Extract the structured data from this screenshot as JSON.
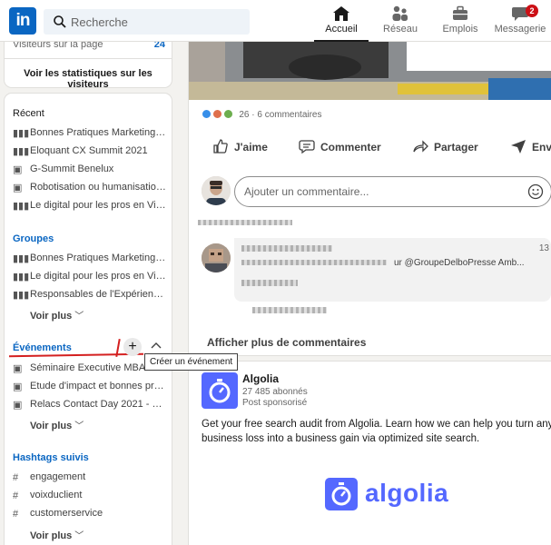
{
  "topbar": {
    "logo": "in",
    "search_placeholder": "Recherche",
    "nav": [
      {
        "label": "Accueil"
      },
      {
        "label": "Réseau"
      },
      {
        "label": "Emplois"
      },
      {
        "label": "Messagerie",
        "badge": "2"
      }
    ]
  },
  "left": {
    "stats": {
      "label": "Visiteurs sur la page",
      "count": "24",
      "link": "Voir les statistiques sur les visiteurs"
    },
    "recent": {
      "title": "Récent",
      "items": [
        "Bonnes Pratiques Marketing, p...",
        "Eloquant CX Summit 2021",
        "G-Summit Benelux",
        "Robotisation ou humanisation...",
        "Le digital pour les pros en Vid..."
      ]
    },
    "groups": {
      "title": "Groupes",
      "items": [
        "Bonnes Pratiques Marketing, p...",
        "Le digital pour les pros en Vid...",
        "Responsables de l'Expérience ..."
      ],
      "see_more": "Voir plus"
    },
    "events": {
      "title": "Événements",
      "tooltip": "Créer un événement",
      "items": [
        "Séminaire Executive MBA HE...",
        "Etude d'impact et bonnes prat...",
        "Relacs Contact Day 2021 - L'év..."
      ],
      "see_more": "Voir plus"
    },
    "hashtags": {
      "title": "Hashtags suivis",
      "items": [
        "engagement",
        "voixduclient",
        "customerservice"
      ],
      "see_more": "Voir plus"
    }
  },
  "feed": {
    "reactions_count": "26",
    "comments_count": "6 commentaires",
    "actions": [
      "J'aime",
      "Commenter",
      "Partager",
      "Envoyer"
    ],
    "comment_placeholder": "Ajouter un commentaire...",
    "comment_snippet": "ur @GroupeDelboPresse Amb...",
    "comment_time": "13",
    "more_comments": "Afficher plus de commentaires"
  },
  "ad": {
    "company": "Algolia",
    "followers": "27 485 abonnés",
    "sponsored": "Post sponsorisé",
    "text_line1": "Get your free search audit from Algolia. Learn how we can help you turn any",
    "text_line2": "business loss into a business gain via optimized site search.",
    "brand_word": "algolia",
    "brand_color": "#5468ff"
  },
  "colors": {
    "linkedin_blue": "#0a66c2",
    "annotation_red": "#d42020"
  }
}
